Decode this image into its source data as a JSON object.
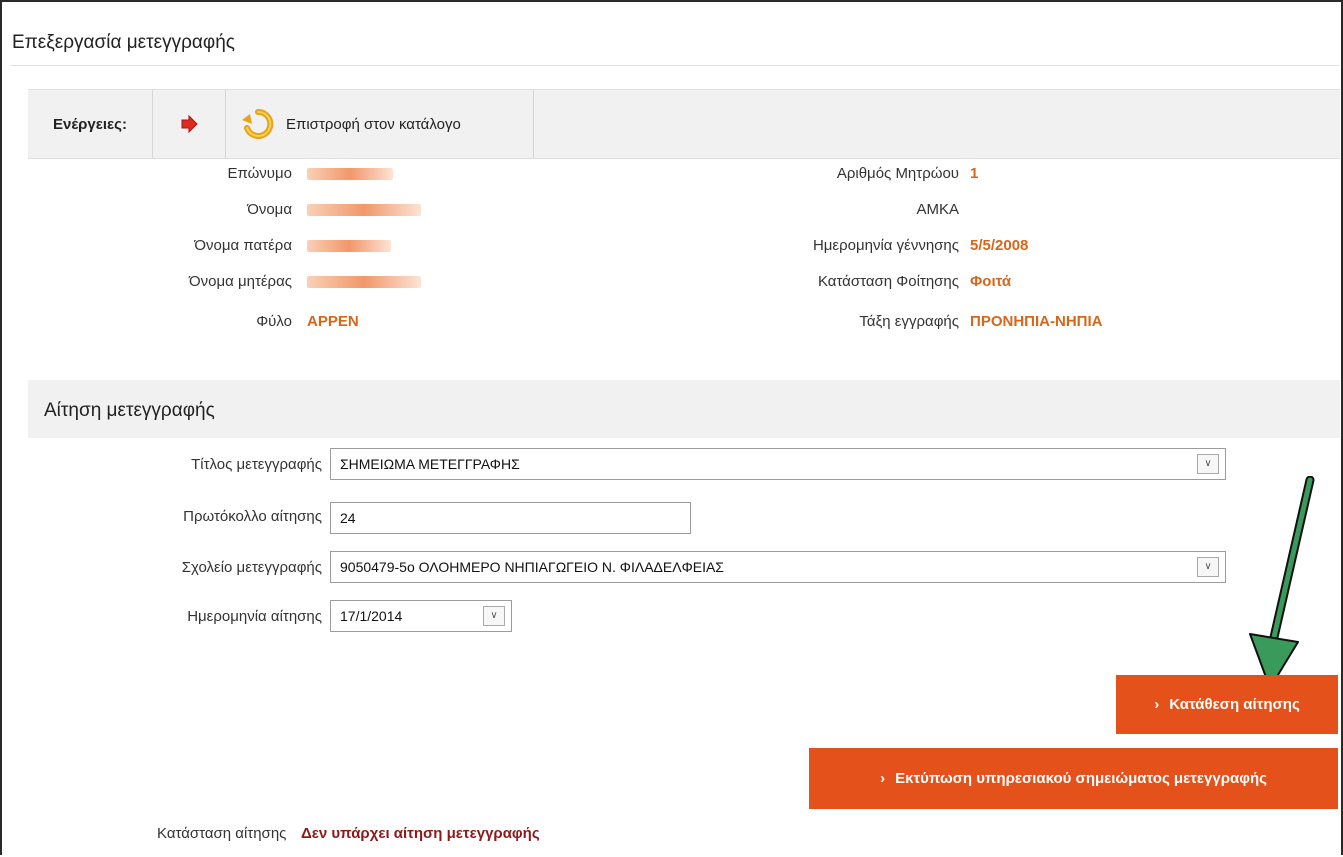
{
  "page": {
    "title": "Επεξεργασία μετεγγραφής"
  },
  "toolbar": {
    "label": "Ενέργειες:",
    "arrow_icon": "red-arrow-icon",
    "back_icon": "return-arrow-icon",
    "back_label": "Επιστροφή στον κατάλογο"
  },
  "student": {
    "left": [
      {
        "label": "Επώνυμο",
        "value": ""
      },
      {
        "label": "Όνομα",
        "value": ""
      },
      {
        "label": "Όνομα πατέρα",
        "value": ""
      },
      {
        "label": "Όνομα μητέρας",
        "value": ""
      },
      {
        "label": "Φύλο",
        "value": "ΑΡΡΕΝ"
      }
    ],
    "right": [
      {
        "label": "Αριθμός Μητρώου",
        "value": "1"
      },
      {
        "label": "ΑΜΚΑ",
        "value": ""
      },
      {
        "label": "Ημερομηνία γέννησης",
        "value": "5/5/2008"
      },
      {
        "label": "Κατάσταση Φοίτησης",
        "value": "Φοιτά"
      },
      {
        "label": "Τάξη εγγραφής",
        "value": "ΠΡΟΝΗΠΙΑ-ΝΗΠΙΑ"
      }
    ]
  },
  "request": {
    "section_title": "Αίτηση μετεγγραφής",
    "title_label": "Τίτλος μετεγγραφής",
    "title_value": "ΣΗΜΕΙΩΜΑ ΜΕΤΕΓΓΡΑΦΗΣ",
    "protocol_label": "Πρωτόκολλο αίτησης",
    "protocol_value": "24",
    "school_label": "Σχολείο μετεγγραφής",
    "school_value": "9050479-5ο ΟΛΟΗΜΕΡΟ ΝΗΠΙΑΓΩΓΕΙΟ Ν. ΦΙΛΑΔΕΛΦΕΙΑΣ",
    "date_label": "Ημερομηνία αίτησης",
    "date_value": "17/1/2014"
  },
  "buttons": {
    "submit_label": "Κατάθεση αίτησης",
    "print_label": "Εκτύπωση υπηρεσιακού σημειώματος μετεγγραφής"
  },
  "status": {
    "label": "Κατάσταση αίτησης",
    "value": "Δεν υπάρχει αίτηση μετεγγραφής"
  },
  "colors": {
    "accent": "#e4511a",
    "value_text": "#d8661a",
    "status_text": "#8b1a1a",
    "annotation_arrow": "#2e8b57"
  }
}
